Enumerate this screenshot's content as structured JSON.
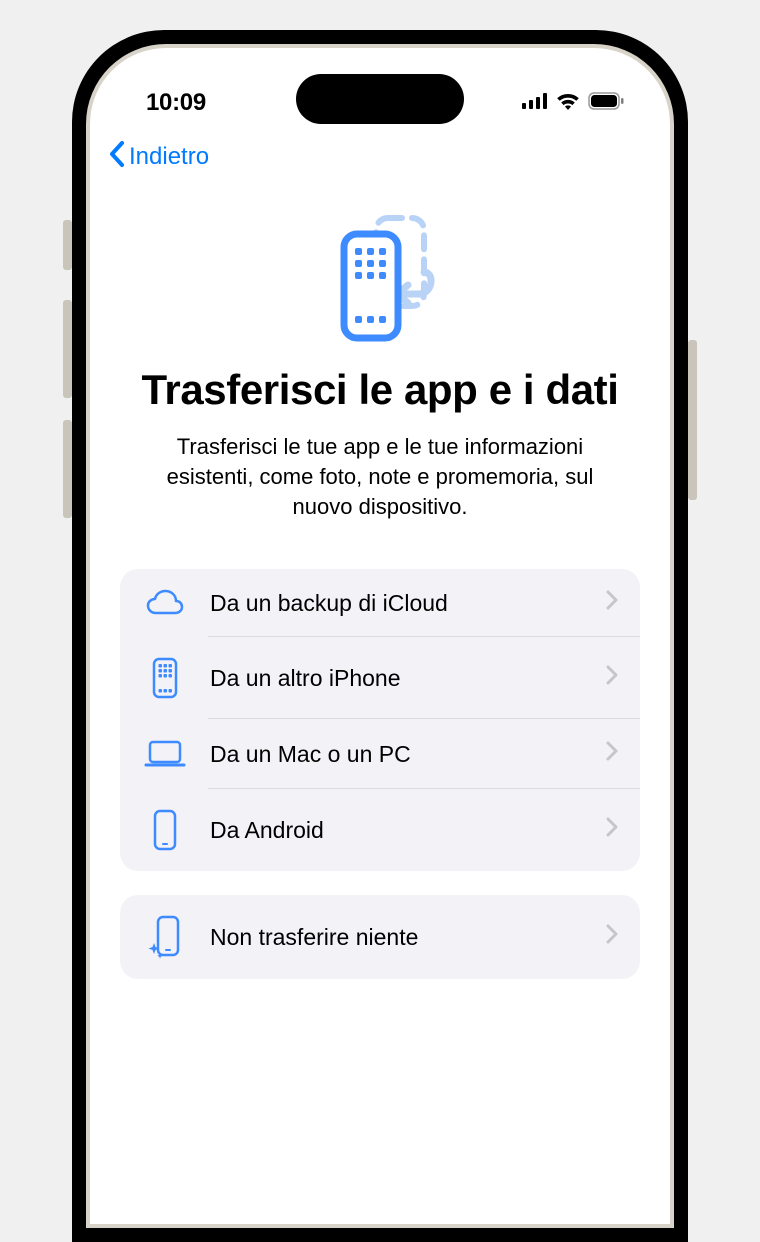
{
  "status_bar": {
    "time": "10:09"
  },
  "nav": {
    "back_label": "Indietro"
  },
  "page": {
    "title": "Trasferisci le app e i dati",
    "subtitle": "Trasferisci le tue app e le tue informazioni esistenti, come foto, note e promemoria, sul nuovo dispositivo."
  },
  "options_primary": [
    {
      "icon": "cloud",
      "label": "Da un backup di iCloud"
    },
    {
      "icon": "iphone-apps",
      "label": "Da un altro iPhone"
    },
    {
      "icon": "laptop",
      "label": "Da un Mac o un PC"
    },
    {
      "icon": "phone-plain",
      "label": "Da Android"
    }
  ],
  "options_secondary": [
    {
      "icon": "phone-sparkle",
      "label": "Non trasferire niente"
    }
  ],
  "colors": {
    "accent": "#007AFF",
    "icon_blue": "#3d8bff",
    "card_bg": "#f3f2f7",
    "divider": "#dcdbe0",
    "chevron": "#c6c6c9"
  }
}
